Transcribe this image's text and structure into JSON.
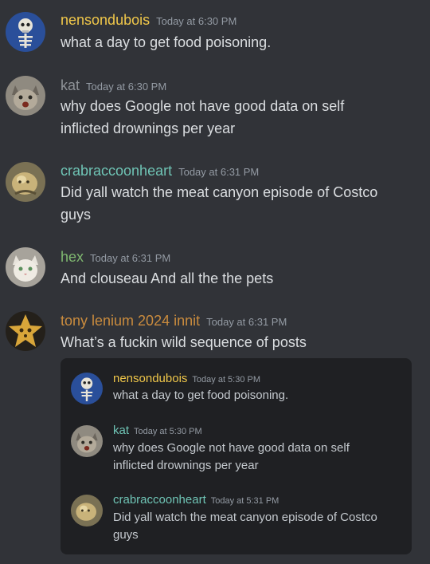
{
  "colors": {
    "background": "#313338",
    "embed_background": "#1f2023",
    "name_yellow": "#f0c74a",
    "name_gray": "#8e9297",
    "name_teal": "#6fc4b5",
    "name_green": "#7fb770",
    "name_orange": "#c98b3e"
  },
  "messages": [
    {
      "username": "nensondubois",
      "timestamp": "Today at 6:30 PM",
      "lines": [
        "what a day to get food poisoning."
      ],
      "avatar_icon": "skeleton-avatar-icon"
    },
    {
      "username": "kat",
      "timestamp": "Today at 6:30 PM",
      "lines": [
        "why does Google not have good data on self",
        "inflicted drownings per year"
      ],
      "avatar_icon": "cat-avatar-icon"
    },
    {
      "username": "crabraccoonheart",
      "timestamp": "Today at 6:31 PM",
      "lines": [
        "Did yall watch the meat canyon episode of Costco",
        "guys"
      ],
      "avatar_icon": "creature-avatar-icon"
    },
    {
      "username": "hex",
      "timestamp": "Today at 6:31 PM",
      "lines": [
        "And clouseau And all the the pets"
      ],
      "avatar_icon": "cat-avatar-icon"
    },
    {
      "username": "tony lenium 2024 innit",
      "timestamp": "Today at 6:31 PM",
      "lines": [
        "What’s a fuckin wild sequence of posts"
      ],
      "avatar_icon": "star-avatar-icon"
    }
  ],
  "embed": {
    "messages": [
      {
        "username": "nensondubois",
        "timestamp": "Today at 5:30 PM",
        "lines": [
          "what a day to get food poisoning."
        ]
      },
      {
        "username": "kat",
        "timestamp": "Today at 5:30 PM",
        "lines": [
          "why does Google not have good data on self",
          "inflicted drownings per year"
        ]
      },
      {
        "username": "crabraccoonheart",
        "timestamp": "Today at 5:31 PM",
        "lines": [
          "Did yall watch the meat canyon episode of Costco",
          "guys"
        ]
      }
    ]
  }
}
